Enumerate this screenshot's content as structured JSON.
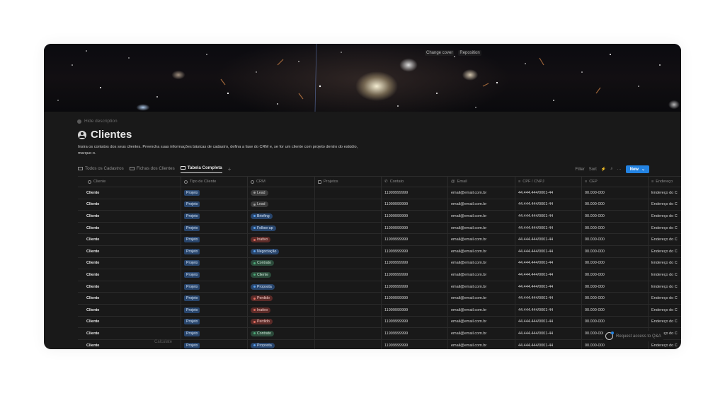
{
  "cover": {
    "change_cover": "Change cover",
    "reposition": "Reposition"
  },
  "page": {
    "hide_description": "Hide description",
    "title": "Clientes",
    "description": "Insira os contatos dos seus clientes. Preencha suas informações básicas de cadastro, defina a fase do CRM e, se for um cliente com projeto dentro do estúdio, marque-o."
  },
  "views": [
    {
      "label": "Todos os Cadastros"
    },
    {
      "label": "Fichas dos Clientes"
    },
    {
      "label": "Tabela Completa"
    }
  ],
  "toolbar": {
    "filter": "Filter",
    "sort": "Sort",
    "new": "New"
  },
  "columns": [
    "Cliente",
    "Tipo de Cliente",
    "CRM",
    "Projetos",
    "Contato",
    "Email",
    "CPF / CNPJ",
    "CEP",
    "Endereço"
  ],
  "colors": {
    "gray": {
      "bg": "#3b3b3b",
      "fg": "#cfcfcf",
      "dot": "#9a9a9a"
    },
    "blue": {
      "bg": "#28456c",
      "fg": "#d7e6f8",
      "dot": "#5aa1ef"
    },
    "red": {
      "bg": "#5c2b28",
      "fg": "#f2c9c4",
      "dot": "#e06a5e"
    },
    "green": {
      "bg": "#2b4a3a",
      "fg": "#cde8d8",
      "dot": "#4dab7a"
    },
    "accent": "#2383e2"
  },
  "rows": [
    {
      "cliente": "Cliente",
      "tipo": "Projeto",
      "crm": "Lead",
      "crm_color": "gray",
      "contato": "11999999999",
      "email": "email@email.com.br",
      "cpf": "44.444.444/0001-44",
      "cep": "00.000-000",
      "endereco": "Endereço do C"
    },
    {
      "cliente": "Cliente",
      "tipo": "Projeto",
      "crm": "Lead",
      "crm_color": "gray",
      "contato": "11999999999",
      "email": "email@email.com.br",
      "cpf": "44.444.444/0001-44",
      "cep": "00.000-000",
      "endereco": "Endereço do C"
    },
    {
      "cliente": "Cliente",
      "tipo": "Projeto",
      "crm": "Briefing",
      "crm_color": "blue",
      "contato": "11999999999",
      "email": "email@email.com.br",
      "cpf": "44.444.444/0001-44",
      "cep": "00.000-000",
      "endereco": "Endereço do C"
    },
    {
      "cliente": "Cliente",
      "tipo": "Projeto",
      "crm": "Follow-up",
      "crm_color": "blue",
      "contato": "11999999999",
      "email": "email@email.com.br",
      "cpf": "44.444.444/0001-44",
      "cep": "00.000-000",
      "endereco": "Endereço do C"
    },
    {
      "cliente": "Cliente",
      "tipo": "Projeto",
      "crm": "Inativo",
      "crm_color": "red",
      "contato": "11999999999",
      "email": "email@email.com.br",
      "cpf": "44.444.444/0001-44",
      "cep": "00.000-000",
      "endereco": "Endereço do C"
    },
    {
      "cliente": "Cliente",
      "tipo": "Projeto",
      "crm": "Negociação",
      "crm_color": "blue",
      "contato": "11999999999",
      "email": "email@email.com.br",
      "cpf": "44.444.444/0001-44",
      "cep": "00.000-000",
      "endereco": "Endereço do C"
    },
    {
      "cliente": "Cliente",
      "tipo": "Projeto",
      "crm": "Contrato",
      "crm_color": "green",
      "contato": "11999999999",
      "email": "email@email.com.br",
      "cpf": "44.444.444/0001-44",
      "cep": "00.000-000",
      "endereco": "Endereço do C"
    },
    {
      "cliente": "Cliente",
      "tipo": "Projeto",
      "crm": "Cliente",
      "crm_color": "green",
      "contato": "11999999999",
      "email": "email@email.com.br",
      "cpf": "44.444.444/0001-44",
      "cep": "00.000-000",
      "endereco": "Endereço do C"
    },
    {
      "cliente": "Cliente",
      "tipo": "Projeto",
      "crm": "Proposta",
      "crm_color": "blue",
      "contato": "11999999999",
      "email": "email@email.com.br",
      "cpf": "44.444.444/0001-44",
      "cep": "00.000-000",
      "endereco": "Endereço do C"
    },
    {
      "cliente": "Cliente",
      "tipo": "Projeto",
      "crm": "Perdido",
      "crm_color": "red",
      "contato": "11999999999",
      "email": "email@email.com.br",
      "cpf": "44.444.444/0001-44",
      "cep": "00.000-000",
      "endereco": "Endereço do C"
    },
    {
      "cliente": "Cliente",
      "tipo": "Projeto",
      "crm": "Inativo",
      "crm_color": "red",
      "contato": "11999999999",
      "email": "email@email.com.br",
      "cpf": "44.444.444/0001-44",
      "cep": "00.000-000",
      "endereco": "Endereço do C"
    },
    {
      "cliente": "Cliente",
      "tipo": "Projeto",
      "crm": "Perdido",
      "crm_color": "red",
      "contato": "11999999999",
      "email": "email@email.com.br",
      "cpf": "44.444.444/0001-44",
      "cep": "00.000-000",
      "endereco": "Endereço do C"
    },
    {
      "cliente": "Cliente",
      "tipo": "Projeto",
      "crm": "Contrato",
      "crm_color": "green",
      "contato": "11999999999",
      "email": "email@email.com.br",
      "cpf": "44.444.444/0001-44",
      "cep": "00.000-000",
      "endereco": "Endereço do C"
    },
    {
      "cliente": "Cliente",
      "tipo": "Projeto",
      "crm": "Proposta",
      "crm_color": "blue",
      "contato": "11999999999",
      "email": "email@email.com.br",
      "cpf": "44.444.444/0001-44",
      "cep": "00.000-000",
      "endereco": "Endereço do C"
    }
  ],
  "footer": {
    "calculate": "Calculate",
    "request_access": "Request access to Q&A"
  }
}
